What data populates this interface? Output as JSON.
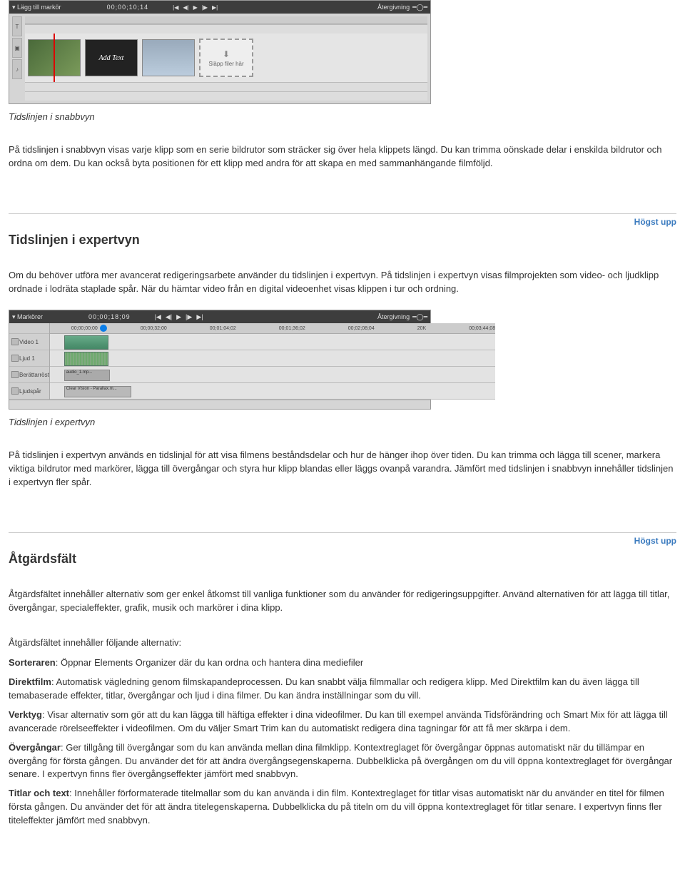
{
  "snabbvyn_editor": {
    "toolbar_label": "Lägg till markör",
    "timecode": "00;00;10;14",
    "right_label": "Återgivning",
    "clips": {
      "addtext": "Add Text",
      "drop_label": "Släpp filer här"
    }
  },
  "caption1": "Tidslinjen i snabbvyn",
  "para1": "På tidslinjen i snabbvyn visas varje klipp som en serie bildrutor som sträcker sig över hela klippets längd. Du kan trimma oönskade delar i enskilda bildrutor och ordna om dem. Du kan också byta positionen för ett klipp med andra för att skapa en med sammanhängande filmföljd.",
  "toplink": "Högst upp",
  "heading1": "Tidslinjen i expertvyn",
  "para2": "Om du behöver utföra mer avancerat redigeringsarbete använder du tidslinjen i expertvyn. På tidslinjen i expertvyn visas filmprojekten som video- och ljudklipp ordnade i lodräta staplade spår. När du hämtar video från en digital videoenhet visas klippen i tur och ordning.",
  "expert_editor": {
    "toolbar_label": "Markörer",
    "timecode": "00;00;18;09",
    "right_label": "Återgivning",
    "ruler_ticks": [
      "00;00;00;00",
      "00;00;32;00",
      "00;01;04;02",
      "00;01;36;02",
      "00;02;08;04",
      "20K",
      "00;03;44;08"
    ],
    "tracks": {
      "video": "Video 1",
      "audio": "Ljud 1",
      "narr": "Berättarröst",
      "sound": "Ljudspår"
    },
    "narr_clip": "audio_1.mp...",
    "sound_clip": "Clear Vision - Parallax.m..."
  },
  "caption2": "Tidslinjen i expertvyn",
  "para3": "På tidslinjen i expertvyn används en tidslinjal för att visa filmens beståndsdelar och hur de hänger ihop över tiden. Du kan trimma och lägga till scener, markera viktiga bildrutor med markörer, lägga till övergångar och styra hur klipp blandas eller läggs ovanpå varandra. Jämfört med tidslinjen i snabbvyn innehåller tidslinjen i expertvyn fler spår.",
  "heading2": "Åtgärdsfält",
  "para4": "Åtgärdsfältet innehåller alternativ som ger enkel åtkomst till vanliga funktioner som du använder för redigeringsuppgifter. Använd alternativen för att lägga till titlar, övergångar, specialeffekter, grafik, musik och markörer i dina klipp.",
  "para5": "Åtgärdsfältet innehåller följande alternativ:",
  "options": {
    "sorteraren_label": "Sorteraren",
    "sorteraren_text": ": Öppnar Elements Organizer där du kan ordna och hantera dina mediefiler",
    "direktfilm_label": "Direktfilm",
    "direktfilm_text": ": Automatisk vägledning genom filmskapandeprocessen. Du kan snabbt välja filmmallar och redigera klipp. Med Direktfilm kan du även lägga till temabaserade effekter, titlar, övergångar och ljud i dina filmer. Du kan ändra inställningar som du vill.",
    "verktyg_label": "Verktyg",
    "verktyg_text": ": Visar alternativ som gör att du kan lägga till häftiga effekter i dina videofilmer. Du kan till exempel använda Tidsförändring och Smart Mix för att lägga till avancerade rörelseeffekter i videofilmen. Om du väljer Smart Trim kan du automatiskt redigera dina tagningar för att få mer skärpa i dem.",
    "overgangar_label": "Övergångar",
    "overgangar_text": ": Ger tillgång till övergångar som du kan använda mellan dina filmklipp. Kontextreglaget för övergångar öppnas automatiskt när du tillämpar en övergång för första gången. Du använder det för att ändra övergångsegenskaperna. Dubbelklicka på övergången om du vill öppna kontextreglaget för övergångar senare. I expertvyn finns fler övergångseffekter jämfört med snabbvyn.",
    "titlar_label": "Titlar och text",
    "titlar_text": ": Innehåller förformaterade titelmallar som du kan använda i din film. Kontextreglaget för titlar visas automatiskt när du använder en titel för filmen första gången. Du använder det för att ändra titelegenskaperna. Dubbelklicka du på titeln om du vill öppna kontextreglaget för titlar senare. I expertvyn finns fler titeleffekter jämfört med snabbvyn."
  }
}
